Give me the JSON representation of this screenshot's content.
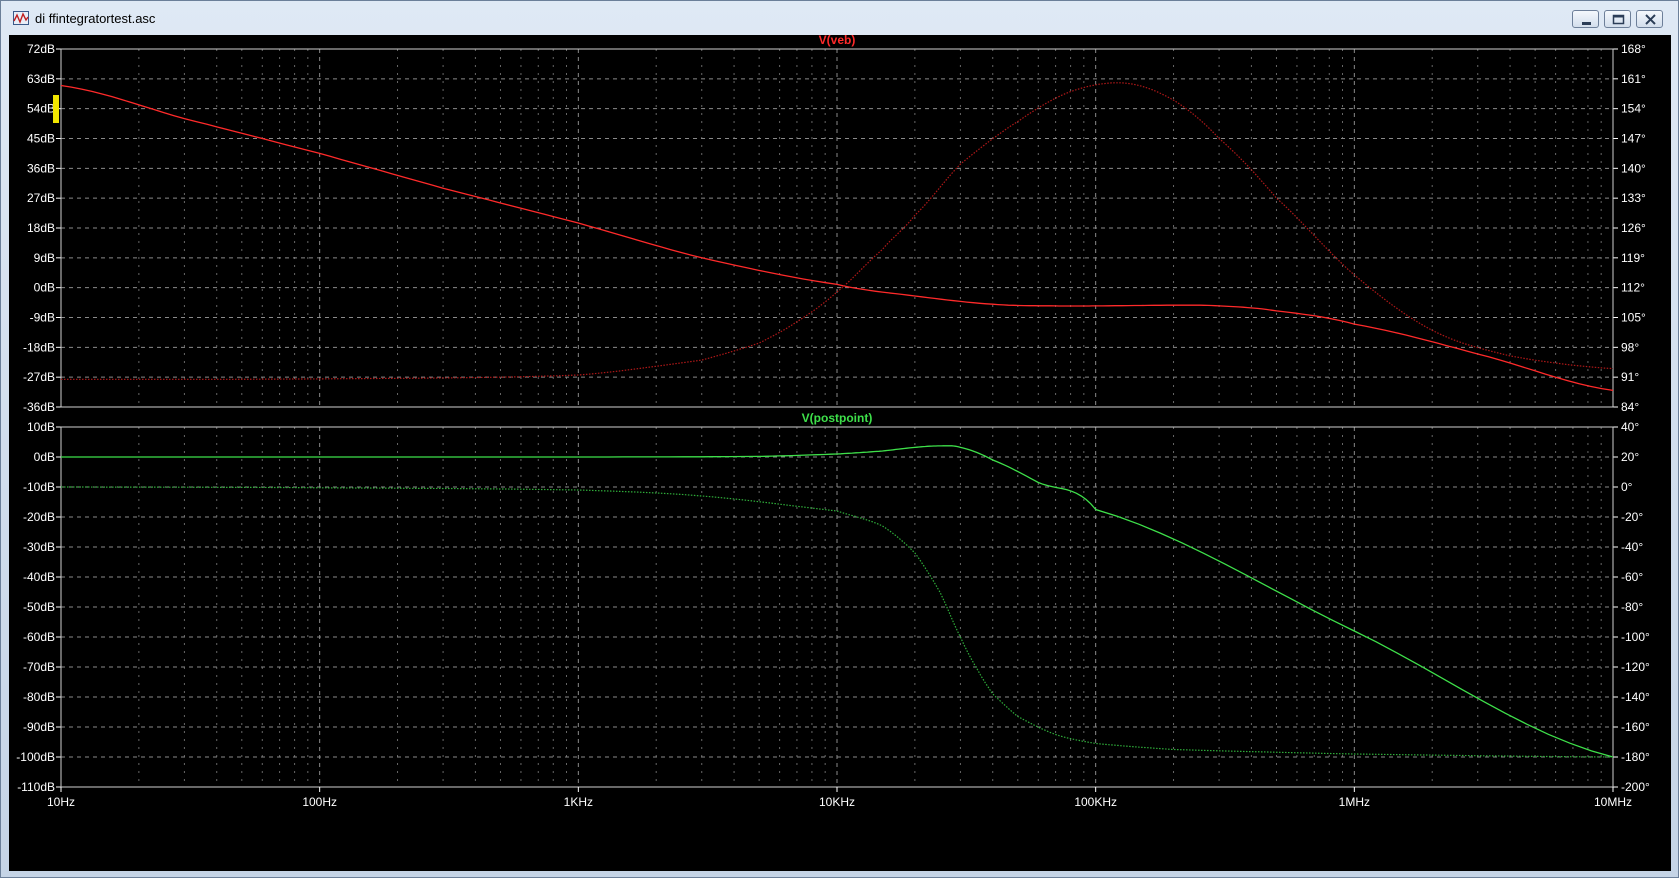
{
  "window": {
    "title": "di ffintegratortest.asc",
    "icon": "waveform-icon",
    "buttons": [
      "minimize-icon",
      "maximize-icon",
      "close-icon"
    ]
  },
  "colors": {
    "background": "#000000",
    "grid": "#8a8a8a",
    "axis_text": "#ffffff",
    "top_trace": "#ff2a2a",
    "top_phase": "#b01818",
    "bottom_trace": "#3ee04a",
    "bottom_phase": "#2fae3a"
  },
  "chart_data": [
    {
      "type": "line",
      "title": "V(veb)",
      "x_scale": "log",
      "x_ticks": [
        "10Hz",
        "100Hz",
        "1KHz",
        "10KHz",
        "100KHz",
        "1MHz",
        "10MHz"
      ],
      "xlim": [
        10,
        10000000
      ],
      "ylim_left": [
        -36,
        72
      ],
      "y_ticks_left": [
        "72dB",
        "63dB",
        "54dB",
        "45dB",
        "36dB",
        "27dB",
        "18dB",
        "9dB",
        "0dB",
        "-9dB",
        "-18dB",
        "-27dB",
        "-36dB"
      ],
      "ylim_right": [
        84,
        161
      ],
      "y_ticks_right": [
        "168°",
        "161°",
        "154°",
        "147°",
        "140°",
        "133°",
        "126°",
        "119°",
        "112°",
        "105°",
        "98°",
        "91°",
        "84°"
      ],
      "grid": true,
      "series": [
        {
          "name": "magnitude",
          "axis": "left",
          "style": "solid",
          "x": [
            10,
            30,
            100,
            300,
            1000,
            3000,
            10000,
            20000,
            40000,
            70000,
            100000,
            200000,
            300000,
            500000,
            1000000,
            3000000,
            10000000
          ],
          "y": [
            61,
            51,
            40.5,
            30,
            19.5,
            9,
            1,
            -2.5,
            -5,
            -5.5,
            -5.5,
            -5.3,
            -5.5,
            -7,
            -11,
            -20,
            -31
          ]
        },
        {
          "name": "phase",
          "axis": "right",
          "style": "dotted",
          "x": [
            10,
            100,
            1000,
            3000,
            5000,
            7000,
            10000,
            15000,
            20000,
            30000,
            50000,
            80000,
            130000,
            200000,
            300000,
            500000,
            1000000,
            2000000,
            4000000,
            10000000
          ],
          "y": [
            90.5,
            90.6,
            91.5,
            95,
            99,
            104,
            111,
            121,
            129,
            141,
            151,
            158,
            160,
            156,
            147,
            133,
            115,
            102,
            96,
            93
          ]
        }
      ]
    },
    {
      "type": "line",
      "title": "V(postpoint)",
      "x_scale": "log",
      "x_ticks": [
        "10Hz",
        "100Hz",
        "1KHz",
        "10KHz",
        "100KHz",
        "1MHz",
        "10MHz"
      ],
      "xlim": [
        10,
        10000000
      ],
      "ylim_left": [
        -110,
        10
      ],
      "y_ticks_left": [
        "10dB",
        "0dB",
        "-10dB",
        "-20dB",
        "-30dB",
        "-40dB",
        "-50dB",
        "-60dB",
        "-70dB",
        "-80dB",
        "-90dB",
        "-100dB",
        "-110dB"
      ],
      "ylim_right": [
        -200,
        40
      ],
      "y_ticks_right": [
        "40°",
        "20°",
        "0°",
        "-20°",
        "-40°",
        "-60°",
        "-80°",
        "-100°",
        "-120°",
        "-140°",
        "-160°",
        "-180°",
        "-200°"
      ],
      "grid": true,
      "series": [
        {
          "name": "magnitude",
          "axis": "left",
          "style": "solid",
          "x": [
            10,
            1000,
            5000,
            10000,
            15000,
            20000,
            25000,
            30000,
            40000,
            60000,
            100000,
            1000000,
            10000000
          ],
          "y": [
            0,
            0,
            0.2,
            1,
            2,
            3.2,
            3.7,
            3.2,
            -1,
            -8.5,
            -17.5,
            -58,
            -100
          ]
        },
        {
          "name": "phase",
          "axis": "right",
          "style": "dotted",
          "x": [
            10,
            100,
            1000,
            3000,
            10000,
            15000,
            20000,
            25000,
            30000,
            35000,
            40000,
            50000,
            70000,
            100000,
            200000,
            1000000,
            10000000
          ],
          "y": [
            0,
            -0.5,
            -2,
            -6,
            -16,
            -26,
            -44,
            -70,
            -100,
            -122,
            -138,
            -153,
            -165,
            -171,
            -175,
            -178,
            -180
          ]
        }
      ]
    }
  ]
}
